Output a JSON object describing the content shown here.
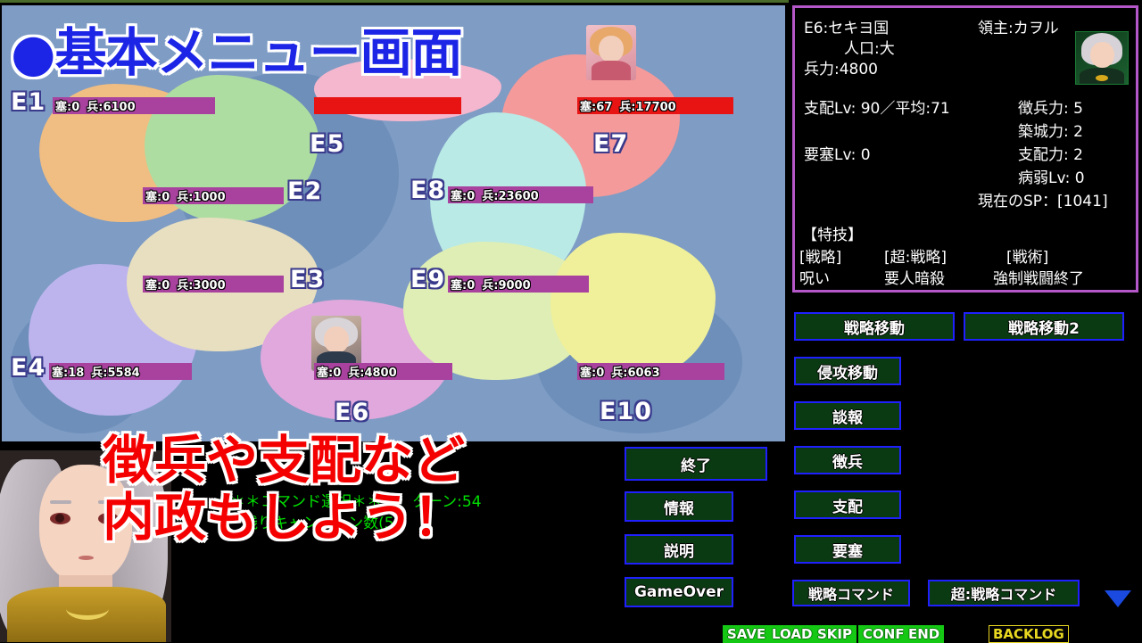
{
  "map": {
    "title": "●基本メニュー画面",
    "regions": [
      {
        "id": "E1",
        "fort": "塞:0",
        "troops": "兵:6100",
        "side": "ally"
      },
      {
        "id": "E2",
        "fort": "塞:0",
        "troops": "兵:1000",
        "side": "ally"
      },
      {
        "id": "E3",
        "fort": "塞:0",
        "troops": "兵:3000",
        "side": "ally"
      },
      {
        "id": "E4",
        "fort": "塞:18",
        "troops": "兵:5584",
        "side": "ally"
      },
      {
        "id": "E5",
        "fort": "",
        "troops": "",
        "side": "enemy"
      },
      {
        "id": "E6",
        "fort": "塞:0",
        "troops": "兵:4800",
        "side": "ally"
      },
      {
        "id": "E7",
        "fort": "塞:67",
        "troops": "兵:17700",
        "side": "enemy"
      },
      {
        "id": "E8",
        "fort": "塞:0",
        "troops": "兵:23600",
        "side": "ally"
      },
      {
        "id": "E9",
        "fort": "塞:0",
        "troops": "兵:9000",
        "side": "ally"
      },
      {
        "id": "E10",
        "fort": "塞:0",
        "troops": "兵:6063",
        "side": "ally"
      }
    ]
  },
  "info": {
    "region_name": "E6:セキヨ国",
    "lord": "領主:カヲル",
    "population": "人口:大",
    "military": "兵力:4800",
    "rule_lv": "支配Lv: 90／平均:71",
    "fort_lv": "要塞Lv: 0",
    "conscript_power": "徴兵力: 5",
    "build_power": "築城力: 2",
    "rule_power": "支配力: 2",
    "sick_lv": "病弱Lv: 0",
    "current_sp": "現在のSP：[1041]",
    "skills_header": "【特技】",
    "skill_cat_1": "[戦略]",
    "skill_cat_2": "[超:戦略]",
    "skill_cat_3": "[戦術]",
    "skill_1": "呪い",
    "skill_2": "要人暗殺",
    "skill_3": "強制戦闘終了"
  },
  "commands": {
    "move_strategy": "戦略移動",
    "move_strategy2": "戦略移動2",
    "move_invade": "侵攻移動",
    "intel": "談報",
    "conscript": "徴兵",
    "rule": "支配",
    "fortress": "要塞",
    "strategy_command": "戦略コマンド",
    "super_strategy_command": "超:戦略コマンド"
  },
  "left_menu": {
    "end": "終了",
    "info": "情報",
    "explain": "説明",
    "gameover": "GameOver"
  },
  "status": {
    "line1": "＊＊コマンド選択＊＊　　ターン:54",
    "line2": "残りキャンペーン数(5)"
  },
  "caption": {
    "line1": "徴兵や支配など",
    "line2": "内政もしよう！"
  },
  "system_bar": {
    "save": "SAVE",
    "load": "LOAD",
    "skip": "SKIP",
    "conf": "CONF",
    "end": "END",
    "backlog": "BACKLOG"
  },
  "colors": {
    "panel_border": "#b457c8",
    "button_border": "#2020ff",
    "button_fill": "#0a3a12",
    "ally_bar": "#a8429e",
    "enemy_bar": "#e81414",
    "status_green": "#00e000",
    "caption_red": "#f40000",
    "title_blue": "#1c25e6"
  }
}
